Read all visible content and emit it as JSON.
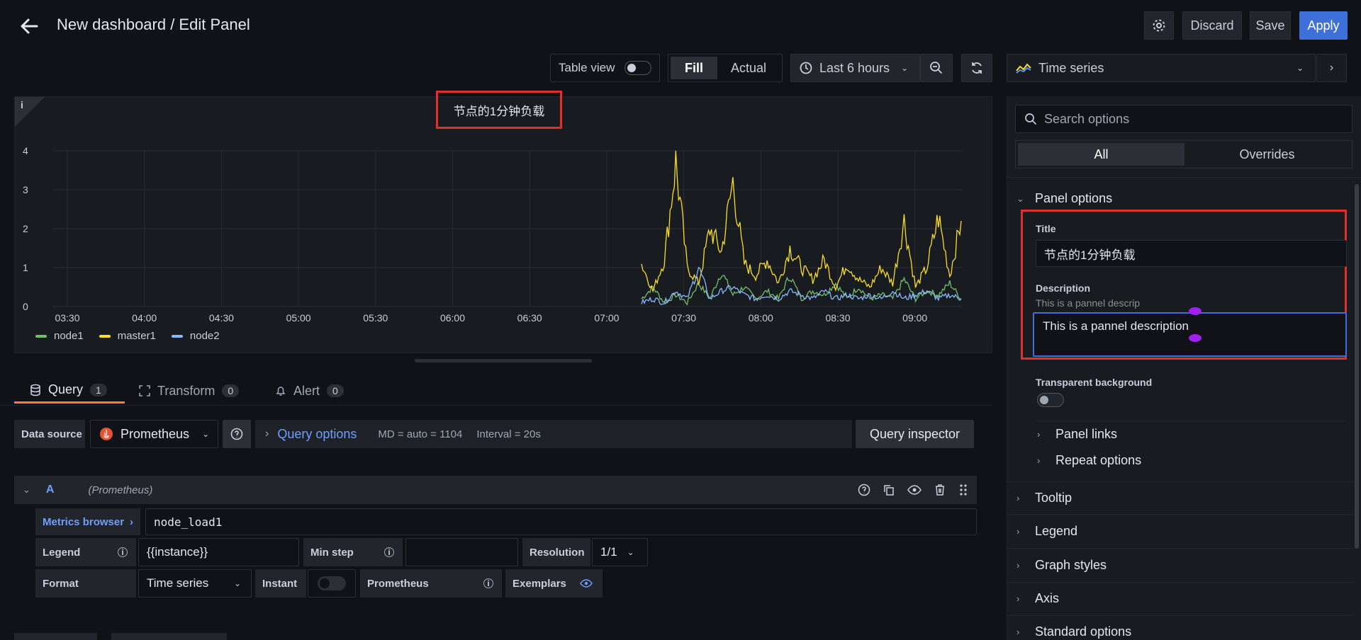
{
  "header": {
    "title": "New dashboard / Edit Panel",
    "discard": "Discard",
    "save": "Save",
    "apply": "Apply"
  },
  "toolbar": {
    "table_view": "Table view",
    "fill": "Fill",
    "actual": "Actual",
    "time_range": "Last 6 hours",
    "viz_type": "Time series"
  },
  "panel": {
    "title": "节点的1分钟负载",
    "info": "i",
    "legend": [
      {
        "name": "node1",
        "color": "#73bf69"
      },
      {
        "name": "master1",
        "color": "#fade2a"
      },
      {
        "name": "node2",
        "color": "#8ab8ff"
      }
    ]
  },
  "chart_data": {
    "type": "line",
    "x_ticks": [
      "03:30",
      "04:00",
      "04:30",
      "05:00",
      "05:30",
      "06:00",
      "06:30",
      "07:00",
      "07:30",
      "08:00",
      "08:30",
      "09:00"
    ],
    "y_ticks": [
      "0",
      "1",
      "2",
      "3",
      "4"
    ],
    "ylim": [
      0,
      4
    ],
    "series": [
      {
        "name": "node1",
        "values": [
          0.2,
          0.5,
          0.1,
          0.3,
          0.1,
          0.6,
          0.2,
          0.9,
          0.3,
          0.5,
          0.2,
          0.4,
          0.2,
          0.8,
          0.2,
          0.4,
          0.3,
          0.6,
          0.2,
          0.5,
          0.2,
          0.3,
          0.2,
          0.7,
          0.2,
          0.4,
          0.3,
          0.6,
          0.2
        ]
      },
      {
        "name": "master1",
        "values": [
          1.1,
          0.4,
          1.2,
          3.7,
          1.0,
          0.6,
          2.0,
          1.4,
          3.2,
          1.1,
          0.8,
          1.2,
          0.6,
          1.5,
          1.0,
          0.7,
          1.2,
          0.5,
          1.1,
          0.7,
          0.5,
          1.0,
          0.6,
          2.2,
          0.5,
          1.0,
          2.3,
          0.8,
          2.2
        ]
      },
      {
        "name": "node2",
        "values": [
          0.1,
          0.2,
          0.1,
          0.4,
          0.2,
          1.0,
          0.2,
          0.4,
          0.5,
          0.3,
          0.2,
          0.3,
          0.2,
          0.4,
          0.3,
          0.2,
          0.4,
          0.2,
          0.3,
          0.2,
          0.3,
          0.2,
          0.4,
          0.2,
          0.3,
          0.4,
          0.2,
          0.3,
          0.2
        ]
      }
    ]
  },
  "tabs": {
    "query": "Query",
    "query_count": "1",
    "transform": "Transform",
    "transform_count": "0",
    "alert": "Alert",
    "alert_count": "0"
  },
  "query": {
    "data_source_label": "Data source",
    "data_source": "Prometheus",
    "query_options": "Query options",
    "md": "MD = auto = 1104",
    "interval": "Interval = 20s",
    "inspector": "Query inspector",
    "ref": "A",
    "ref_source": "(Prometheus)",
    "metrics_browser": "Metrics browser",
    "expr": "node_load1",
    "legend_label": "Legend",
    "legend_value": "{{instance}}",
    "min_step_label": "Min step",
    "resolution_label": "Resolution",
    "resolution_value": "1/1",
    "format_label": "Format",
    "format_value": "Time series",
    "instant_label": "Instant",
    "prometheus_label": "Prometheus",
    "exemplars_label": "Exemplars"
  },
  "options": {
    "search_placeholder": "Search options",
    "tab_all": "All",
    "tab_overrides": "Overrides",
    "panel_options": "Panel options",
    "title_label": "Title",
    "title_value": "节点的1分钟负载",
    "description_label": "Description",
    "description_hint": "This is a pannel descrip",
    "description_value": "This is a pannel description",
    "transparent_label": "Transparent background",
    "panel_links": "Panel links",
    "repeat_options": "Repeat options",
    "tooltip": "Tooltip",
    "legend": "Legend",
    "graph_styles": "Graph styles",
    "axis": "Axis",
    "standard_options": "Standard options"
  }
}
